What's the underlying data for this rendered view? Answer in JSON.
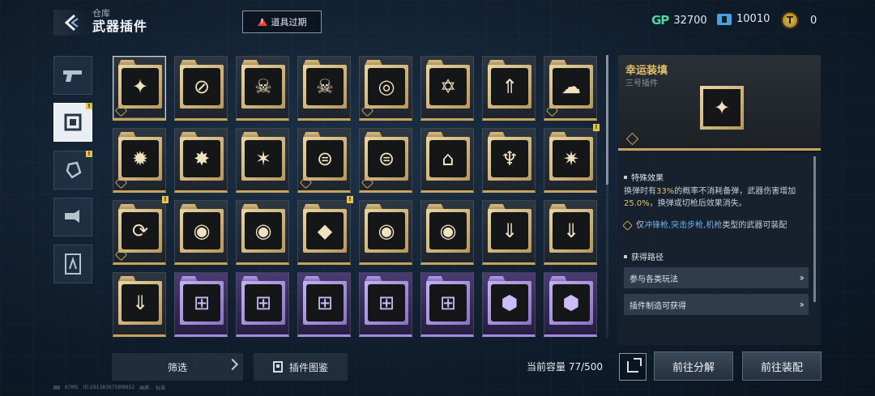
{
  "header": {
    "subtitle": "仓库",
    "title": "武器插件",
    "expired_button": "道具过期"
  },
  "currencies": [
    {
      "icon": "gp-icon",
      "label": "GP",
      "value": "32700"
    },
    {
      "icon": "ticket-icon",
      "value": "10010"
    },
    {
      "icon": "coin-icon",
      "value": "0"
    }
  ],
  "categories": [
    {
      "name": "weapon-category",
      "icon": "pistol-icon",
      "active": false
    },
    {
      "name": "plugin-category",
      "icon": "chip-icon",
      "active": true,
      "badge": "!"
    },
    {
      "name": "attachment-category",
      "icon": "grenade-icon",
      "active": false,
      "badge": "!"
    },
    {
      "name": "mod-category",
      "icon": "gauntlet-icon",
      "active": false
    },
    {
      "name": "skin-category",
      "icon": "character-icon",
      "active": false
    }
  ],
  "items": [
    {
      "rarity": "gold",
      "glyph": "✦",
      "corner": true,
      "selected": true
    },
    {
      "rarity": "gold",
      "glyph": "⊘"
    },
    {
      "rarity": "gold",
      "glyph": "☠"
    },
    {
      "rarity": "gold",
      "glyph": "☠"
    },
    {
      "rarity": "gold",
      "glyph": "◎",
      "corner": true
    },
    {
      "rarity": "gold",
      "glyph": "✡"
    },
    {
      "rarity": "gold",
      "glyph": "⇑"
    },
    {
      "rarity": "gold",
      "glyph": "☁",
      "corner": true
    },
    {
      "rarity": "gold",
      "glyph": "✹",
      "corner": true
    },
    {
      "rarity": "gold",
      "glyph": "✸"
    },
    {
      "rarity": "gold",
      "glyph": "✶"
    },
    {
      "rarity": "gold",
      "glyph": "⊜",
      "corner": true
    },
    {
      "rarity": "gold",
      "glyph": "⊜",
      "corner": true
    },
    {
      "rarity": "gold",
      "glyph": "⌂"
    },
    {
      "rarity": "gold",
      "glyph": "♆"
    },
    {
      "rarity": "gold",
      "glyph": "✷",
      "badge": "!"
    },
    {
      "rarity": "gold",
      "glyph": "⟳",
      "corner": true,
      "badge": "!"
    },
    {
      "rarity": "gold",
      "glyph": "◉"
    },
    {
      "rarity": "gold",
      "glyph": "◉"
    },
    {
      "rarity": "gold",
      "glyph": "◆",
      "badge": "!"
    },
    {
      "rarity": "gold",
      "glyph": "◉"
    },
    {
      "rarity": "gold",
      "glyph": "◉"
    },
    {
      "rarity": "gold",
      "glyph": "⇓"
    },
    {
      "rarity": "gold",
      "glyph": "⇓"
    },
    {
      "rarity": "gold",
      "glyph": "⇓"
    },
    {
      "rarity": "purple",
      "glyph": "⊞"
    },
    {
      "rarity": "purple",
      "glyph": "⊞"
    },
    {
      "rarity": "purple",
      "glyph": "⊞"
    },
    {
      "rarity": "purple",
      "glyph": "⊞"
    },
    {
      "rarity": "purple",
      "glyph": "⊞"
    },
    {
      "rarity": "purple",
      "glyph": "⬢"
    },
    {
      "rarity": "purple",
      "glyph": "⬢"
    }
  ],
  "bottom": {
    "filter_label": "筛选",
    "codex_label": "插件图鉴",
    "capacity_label": "当前容量",
    "capacity_value": "77/500",
    "dismantle_button": "前往分解",
    "equip_button": "前往装配"
  },
  "footer": {
    "ping": "67MS",
    "uid": "ID:2913836758l9652",
    "quality_label": "画质:",
    "quality_value": "标准"
  },
  "detail": {
    "name": "幸运装填",
    "subtitle": "三号插件",
    "special_effect_title": "特殊效果",
    "effect_part1": "换弹时有",
    "effect_hl1": "33%",
    "effect_part2": "的概率不消耗备弹，武器伤害增加",
    "effect_hl2": "25.0%",
    "effect_part3": "，换弹或切枪后效果消失。",
    "restrict_prefix": "仅",
    "restrict_weapons": "冲锋枪,突击步枪,机枪",
    "restrict_suffix": "类型的武器可装配",
    "acquire_title": "获得路径",
    "routes": [
      "参与各类玩法",
      "插件制造可获得"
    ]
  },
  "colors": {
    "gold": "#c9a35a",
    "purple": "#a88ae6",
    "highlight_yellow": "#e6c36a",
    "highlight_blue": "#6fb2f0",
    "gp_green": "#4fd6a0"
  }
}
